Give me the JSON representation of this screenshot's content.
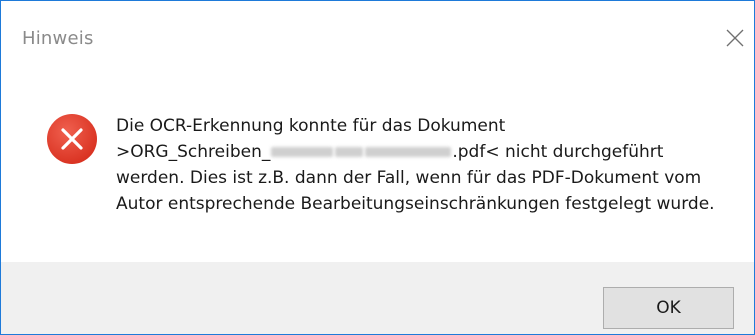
{
  "window": {
    "title": "Hinweis",
    "close_icon": "close-icon"
  },
  "message": {
    "icon": "error-icon",
    "line1": "Die OCR-Erkennung konnte für das Dokument",
    "line2_prefix": ">ORG_Schreiben_",
    "line2_suffix": ".pdf< nicht durchgeführt",
    "line3": "werden. Dies ist z.B. dann der Fall, wenn für das PDF-Dokument vom",
    "line4": "Autor entsprechende Bearbeitungseinschränkungen festgelegt wurde."
  },
  "buttons": {
    "ok_label": "OK"
  },
  "colors": {
    "border": "#1e7ad9",
    "error_red": "#e5402f",
    "footer": "#f0f0f0"
  }
}
